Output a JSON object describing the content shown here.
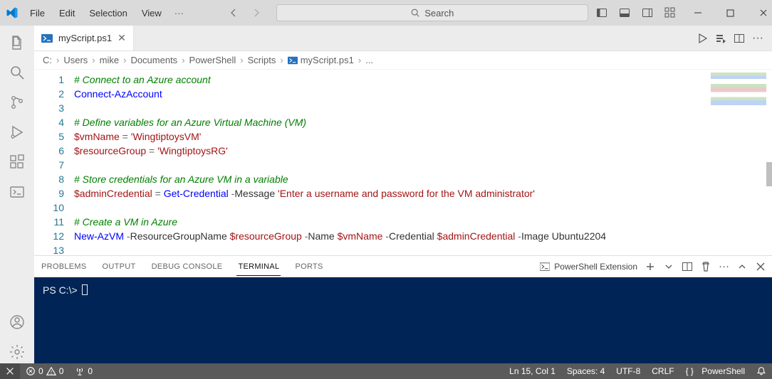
{
  "menubar": {
    "file": "File",
    "edit": "Edit",
    "selection": "Selection",
    "view": "View"
  },
  "search": {
    "placeholder": "Search"
  },
  "tab": {
    "filename": "myScript.ps1"
  },
  "breadcrumbs": [
    "C:",
    "Users",
    "mike",
    "Documents",
    "PowerShell",
    "Scripts",
    "myScript.ps1",
    "..."
  ],
  "code": {
    "lines": [
      {
        "n": 1,
        "segments": [
          {
            "c": "tok-comment",
            "t": "# Connect to an Azure account"
          }
        ]
      },
      {
        "n": 2,
        "segments": [
          {
            "c": "tok-cmdlet",
            "t": "Connect-AzAccount"
          }
        ]
      },
      {
        "n": 3,
        "segments": []
      },
      {
        "n": 4,
        "segments": [
          {
            "c": "tok-comment",
            "t": "# Define variables for an Azure Virtual Machine (VM)"
          }
        ]
      },
      {
        "n": 5,
        "segments": [
          {
            "c": "tok-var",
            "t": "$vmName"
          },
          {
            "c": "tok-op",
            "t": " = "
          },
          {
            "c": "tok-string",
            "t": "'WingtiptoysVM'"
          }
        ]
      },
      {
        "n": 6,
        "segments": [
          {
            "c": "tok-var",
            "t": "$resourceGroup"
          },
          {
            "c": "tok-op",
            "t": " = "
          },
          {
            "c": "tok-string",
            "t": "'WingtiptoysRG'"
          }
        ]
      },
      {
        "n": 7,
        "segments": []
      },
      {
        "n": 8,
        "segments": [
          {
            "c": "tok-comment",
            "t": "# Store credentials for an Azure VM in a variable"
          }
        ]
      },
      {
        "n": 9,
        "segments": [
          {
            "c": "tok-var",
            "t": "$adminCredential"
          },
          {
            "c": "tok-op",
            "t": " = "
          },
          {
            "c": "tok-cmdlet",
            "t": "Get-Credential"
          },
          {
            "c": "tok-op",
            "t": " -"
          },
          {
            "c": "tok-paramname",
            "t": "Message "
          },
          {
            "c": "tok-string",
            "t": "'Enter a username and password for the VM administrator'"
          }
        ]
      },
      {
        "n": 10,
        "segments": []
      },
      {
        "n": 11,
        "segments": [
          {
            "c": "tok-comment",
            "t": "# Create a VM in Azure"
          }
        ]
      },
      {
        "n": 12,
        "segments": [
          {
            "c": "tok-cmdlet",
            "t": "New-AzVM"
          },
          {
            "c": "tok-op",
            "t": " -"
          },
          {
            "c": "tok-paramname",
            "t": "ResourceGroupName "
          },
          {
            "c": "tok-var",
            "t": "$resourceGroup"
          },
          {
            "c": "tok-op",
            "t": " -"
          },
          {
            "c": "tok-paramname",
            "t": "Name "
          },
          {
            "c": "tok-var",
            "t": "$vmName"
          },
          {
            "c": "tok-op",
            "t": " -"
          },
          {
            "c": "tok-paramname",
            "t": "Credential "
          },
          {
            "c": "tok-var",
            "t": "$adminCredential"
          },
          {
            "c": "tok-op",
            "t": " -"
          },
          {
            "c": "tok-paramname",
            "t": "Image "
          },
          {
            "c": "tok-param",
            "t": "Ubuntu2204"
          }
        ]
      },
      {
        "n": 13,
        "segments": []
      }
    ]
  },
  "panel": {
    "tabs": {
      "problems": "PROBLEMS",
      "output": "OUTPUT",
      "debug": "DEBUG CONSOLE",
      "terminal": "TERMINAL",
      "ports": "PORTS"
    },
    "shell_label": "PowerShell Extension",
    "prompt": "PS C:\\> "
  },
  "status": {
    "errors": "0",
    "warnings": "0",
    "ports": "0",
    "lncol": "Ln 15, Col 1",
    "spaces": "Spaces: 4",
    "encoding": "UTF-8",
    "eol": "CRLF",
    "lang": "PowerShell"
  }
}
